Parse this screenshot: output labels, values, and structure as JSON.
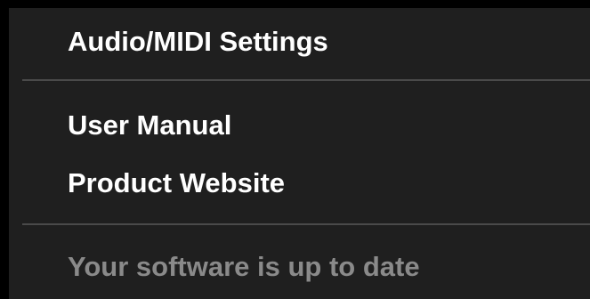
{
  "menu": {
    "items": [
      {
        "label": "Audio/MIDI Settings"
      },
      {
        "label": "User Manual"
      },
      {
        "label": "Product Website"
      },
      {
        "label": "Your software is up to date"
      }
    ]
  },
  "colors": {
    "background": "#1f1f1f",
    "text": "#ffffff",
    "disabled_text": "#8a8a8a",
    "separator": "#4a4a4a"
  }
}
